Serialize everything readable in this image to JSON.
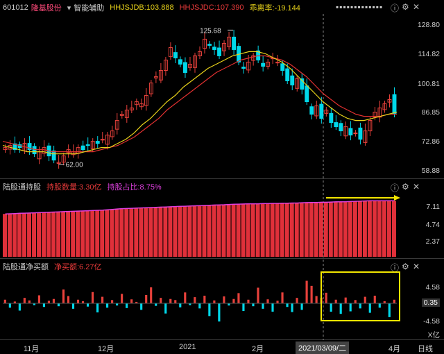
{
  "header": {
    "stock_code": "601012",
    "stock_name": "隆基股份",
    "assist_label": "智能辅助",
    "hhjsjdb": "HHJSJDB:103.888",
    "hhjsjdc": "HHJSJDC:107.390",
    "bias": "乖离率:-19.144"
  },
  "price_axis": {
    "ticks": [
      "128.80",
      "114.82",
      "100.81",
      "86.85",
      "72.86",
      "58.88"
    ],
    "range": [
      58.88,
      128.8
    ]
  },
  "price_annotations": {
    "high": "125.68",
    "low": "62.00"
  },
  "holding_panel": {
    "title": "陆股通持股",
    "amount": "持股数量:3.30亿",
    "ratio": "持股占比:8.75%",
    "ticks": [
      "7.11",
      "4.74",
      "2.37"
    ]
  },
  "netbuy_panel": {
    "title": "陆股通净买额",
    "amount": "净买额:6.27亿",
    "ticks": [
      "4.58",
      "0.35",
      "-4.58"
    ],
    "unit": "X亿"
  },
  "time_axis": {
    "labels": [
      "11月",
      "12月",
      "2021",
      "2月",
      "4月"
    ],
    "cursor_date": "2021/03/09/二",
    "period": "日线"
  },
  "colors": {
    "up": "#e8413b",
    "down": "#00d8ea",
    "ma_yellow": "#e8d21a",
    "ma_red": "#e03030",
    "holding": "#e0303a",
    "highlight": "#f2e600"
  },
  "chart_data": {
    "type": "candlestick",
    "price_series": {
      "close": [
        70,
        71,
        69,
        70,
        72,
        69,
        67,
        68,
        70,
        66,
        64,
        63,
        66,
        69,
        68,
        70,
        69,
        71,
        73,
        72,
        74,
        76,
        78,
        83,
        86,
        88,
        89,
        92,
        91,
        95,
        101,
        104,
        107,
        112,
        118,
        113,
        110,
        106,
        110,
        114,
        116,
        122,
        119,
        117,
        114,
        120,
        123,
        117,
        111,
        108,
        111,
        114,
        112,
        109,
        111,
        113,
        111,
        107,
        102,
        100,
        103,
        98,
        92,
        86,
        90,
        84,
        88,
        82,
        80,
        78,
        80,
        76,
        77,
        74,
        78,
        83,
        87,
        89,
        91,
        93,
        86
      ]
    },
    "ma_yellow": [
      71,
      70,
      69,
      68,
      68,
      68,
      67,
      67,
      67,
      67,
      68,
      69,
      70,
      70,
      72,
      74,
      77,
      81,
      84,
      88,
      92,
      95,
      99,
      102,
      105,
      108,
      110,
      112,
      114,
      115,
      116,
      116,
      115,
      113,
      111,
      108,
      104,
      100,
      96,
      92,
      89,
      86,
      84,
      83,
      83,
      84,
      85,
      86,
      87
    ],
    "ma_red": [
      73,
      72,
      71,
      70,
      69,
      69,
      68,
      68,
      68,
      68,
      68,
      68,
      69,
      70,
      71,
      73,
      75,
      78,
      81,
      84,
      88,
      91,
      94,
      97,
      100,
      103,
      106,
      108,
      110,
      112,
      113,
      114,
      114,
      113,
      112,
      110,
      107,
      104,
      100,
      96,
      93,
      90,
      88,
      86,
      85,
      85,
      85,
      86,
      86
    ],
    "holding_series": [
      5.7,
      5.72,
      5.75,
      5.78,
      5.8,
      5.82,
      5.85,
      5.88,
      5.9,
      5.93,
      5.95,
      5.98,
      6.0,
      6.03,
      6.05,
      6.08,
      6.1,
      6.12,
      6.15,
      6.18,
      6.2,
      6.25,
      6.3,
      6.35,
      6.4,
      6.42,
      6.45,
      6.48,
      6.5,
      6.52,
      6.55,
      6.58,
      6.6,
      6.62,
      6.65,
      6.68,
      6.7,
      6.72,
      6.75,
      6.78,
      6.8,
      6.82,
      6.85,
      6.88,
      6.9,
      6.92,
      6.95,
      6.98,
      7.0,
      7.02,
      7.05,
      7.05,
      7.05,
      7.08,
      7.08,
      7.1,
      7.1,
      7.12,
      7.12,
      7.15,
      7.15,
      7.18,
      7.2,
      7.22,
      7.22,
      7.25,
      7.25,
      7.28,
      7.3,
      7.3,
      7.32,
      7.35,
      7.38,
      7.4,
      7.42,
      7.45,
      7.45,
      7.45,
      7.45,
      7.45,
      7.45
    ],
    "netbuy_series": [
      1.0,
      -1.2,
      0.5,
      -2.0,
      1.5,
      0.8,
      -0.5,
      2.2,
      -1.0,
      0.7,
      1.2,
      -0.8,
      3.8,
      2.0,
      -1.5,
      1.0,
      0.6,
      -0.9,
      3.1,
      -2.5,
      1.8,
      -1.2,
      0.9,
      -0.6,
      2.6,
      -1.3,
      1.1,
      0.4,
      -1.8,
      2.3,
      4.4,
      -0.7,
      1.5,
      -2.8,
      1.2,
      0.9,
      -1.1,
      3.0,
      -0.5,
      1.7,
      -1.4,
      2.1,
      -3.5,
      0.8,
      -5.0,
      1.9,
      -0.6,
      1.2,
      2.8,
      -2.1,
      1.0,
      -0.8,
      4.3,
      -1.5,
      1.1,
      -2.3,
      0.7,
      3.0,
      -1.0,
      -2.4,
      1.5,
      -1.8,
      6.2,
      4.8,
      2.0,
      1.5,
      2.9,
      -2.3,
      1.0,
      -2.9,
      1.6,
      -2.2,
      0.9,
      -1.4,
      1.8,
      -2.6,
      2.1,
      -1.2,
      0.6,
      -3.8,
      1.0
    ]
  }
}
